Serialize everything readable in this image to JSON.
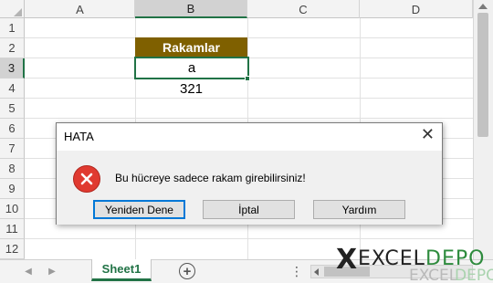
{
  "sheet": {
    "columns": [
      "A",
      "B",
      "C",
      "D"
    ],
    "selected_column": "B",
    "rows": [
      "1",
      "2",
      "3",
      "4",
      "5",
      "6",
      "7",
      "8",
      "9",
      "10",
      "11",
      "12"
    ],
    "selected_row": "3",
    "cells": {
      "B2": "Rakamlar",
      "B3": "a",
      "B4": "321"
    },
    "header_fill": "#7f6000",
    "accent": "#217346"
  },
  "tabs": {
    "active_sheet": "Sheet1",
    "add_icon": "plus-circle-icon",
    "more_icon": "vertical-dots-icon"
  },
  "dialog": {
    "title": "HATA",
    "close_icon": "close-icon",
    "icon": "error-icon",
    "message": "Bu hücreye sadece rakam girebilirsiniz!",
    "buttons": {
      "retry": "Yeniden Dene",
      "cancel": "İptal",
      "help": "Yardım"
    }
  },
  "logo": {
    "mark": "X",
    "text_dark": "EXCEL",
    "text_green": "DEPO",
    "ghost_dark": "EXCEL",
    "ghost_green": "DEPO"
  }
}
